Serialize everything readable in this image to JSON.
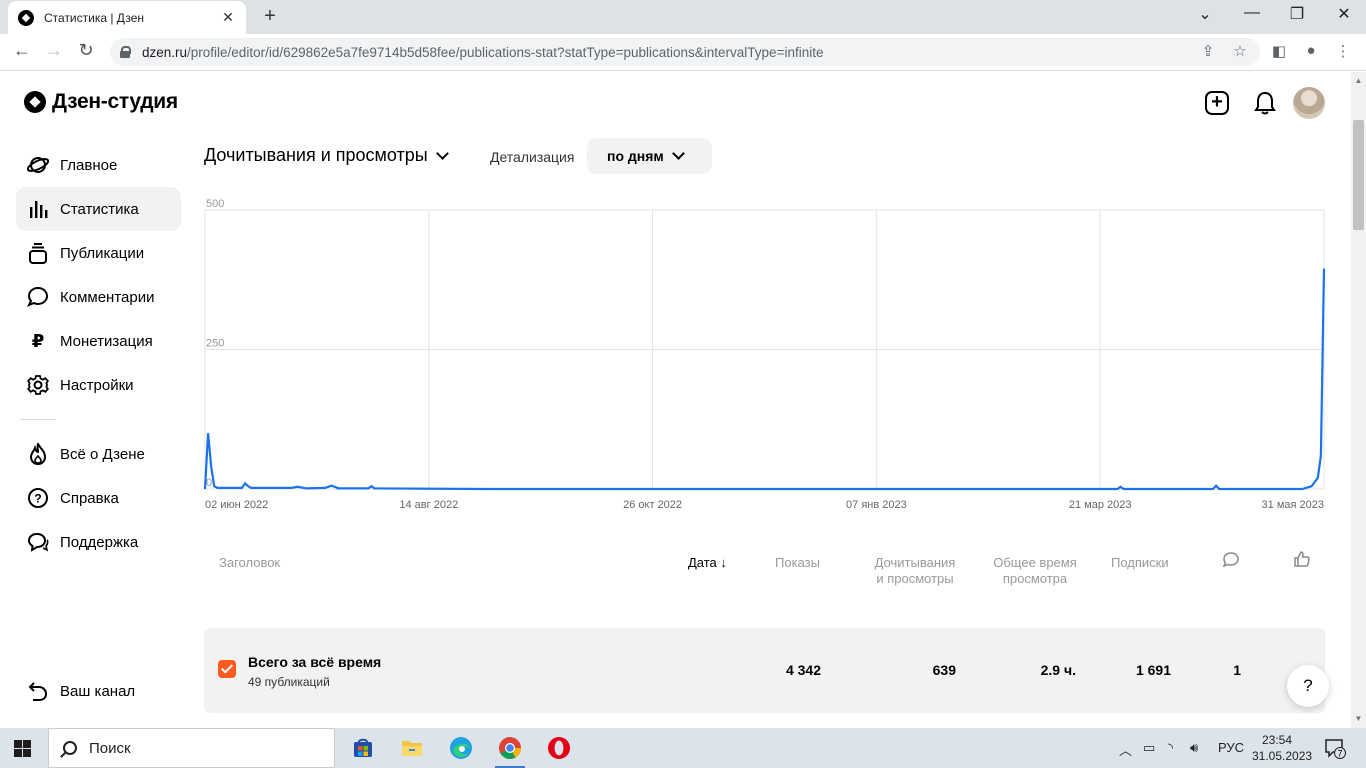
{
  "browser": {
    "tab_title": "Статистика | Дзен",
    "url_host": "dzen.ru",
    "url_path": "/profile/editor/id/629862e5a7fe9714b5d58fee/publications-stat?statType=publications&intervalType=infinite"
  },
  "header": {
    "brand": "Дзен-студия"
  },
  "sidebar": {
    "items": [
      {
        "label": "Главное",
        "icon": "planet-icon"
      },
      {
        "label": "Статистика",
        "icon": "bar-chart-icon",
        "active": true
      },
      {
        "label": "Публикации",
        "icon": "stack-icon"
      },
      {
        "label": "Комментарии",
        "icon": "speech-bubble-icon"
      },
      {
        "label": "Монетизация",
        "icon": "ruble-icon"
      },
      {
        "label": "Настройки",
        "icon": "gear-icon"
      }
    ],
    "secondary": [
      {
        "label": "Всё о Дзене",
        "icon": "flame-icon"
      },
      {
        "label": "Справка",
        "icon": "question-icon"
      },
      {
        "label": "Поддержка",
        "icon": "chat-icon"
      }
    ],
    "back": {
      "label": "Ваш канал",
      "icon": "return-icon"
    }
  },
  "controls": {
    "metric": "Дочитывания и просмотры",
    "detail_label": "Детализация",
    "detail_value": "по дням"
  },
  "chart_data": {
    "type": "line",
    "y_ticks": [
      "500",
      "250",
      "0"
    ],
    "x_ticks": [
      "02 июн 2022",
      "14 авг 2022",
      "26 окт 2022",
      "07 янв 2023",
      "21 мар 2023",
      "31 мая 2023"
    ],
    "ylim": [
      0,
      500
    ],
    "grid": true,
    "color": "#1a73e8",
    "series": [
      {
        "points": [
          [
            "2022-06-02",
            0
          ],
          [
            "2022-06-03",
            100
          ],
          [
            "2022-06-04",
            40
          ],
          [
            "2022-06-05",
            5
          ],
          [
            "2022-06-06",
            2
          ],
          [
            "2022-06-14",
            2
          ],
          [
            "2022-06-15",
            10
          ],
          [
            "2022-06-16",
            5
          ],
          [
            "2022-06-17",
            2
          ],
          [
            "2022-06-30",
            2
          ],
          [
            "2022-07-02",
            4
          ],
          [
            "2022-07-05",
            1
          ],
          [
            "2022-07-15",
            2
          ],
          [
            "2022-07-11",
            2
          ],
          [
            "2022-07-13",
            6
          ],
          [
            "2022-07-15",
            1
          ],
          [
            "2022-07-25",
            1
          ],
          [
            "2022-07-26",
            5
          ],
          [
            "2022-07-27",
            1
          ],
          [
            "2022-09-01",
            0
          ],
          [
            "2022-11-01",
            0
          ],
          [
            "2023-01-01",
            0
          ],
          [
            "2023-03-01",
            0
          ],
          [
            "2023-03-25",
            0
          ],
          [
            "2023-03-26",
            4
          ],
          [
            "2023-03-27",
            0
          ],
          [
            "2023-04-25",
            0
          ],
          [
            "2023-04-26",
            6
          ],
          [
            "2023-04-27",
            0
          ],
          [
            "2023-05-24",
            0
          ],
          [
            "2023-05-27",
            5
          ],
          [
            "2023-05-29",
            20
          ],
          [
            "2023-05-30",
            60
          ],
          [
            "2023-05-31",
            395
          ]
        ]
      }
    ]
  },
  "table": {
    "columns": [
      {
        "label": "Заголовок"
      },
      {
        "label": "Дата",
        "sorted": true
      },
      {
        "label": "Показы"
      },
      {
        "label": "Дочитывания",
        "label2": "и просмотры"
      },
      {
        "label": "Общее время",
        "label2": "просмотра"
      },
      {
        "label": "Подписки"
      },
      {
        "icon": "comment-icon"
      },
      {
        "icon": "like-icon"
      }
    ],
    "summary": {
      "title": "Всего за всё время",
      "subtitle": "49 публикаций",
      "shows": "4 342",
      "reads": "639",
      "time": "2.9 ч.",
      "subs": "1 691",
      "comments": "1"
    }
  },
  "help": "?",
  "taskbar": {
    "search_placeholder": "Поиск",
    "lang": "РУС",
    "time": "23:54",
    "date": "31.05.2023",
    "notifications": "7"
  }
}
